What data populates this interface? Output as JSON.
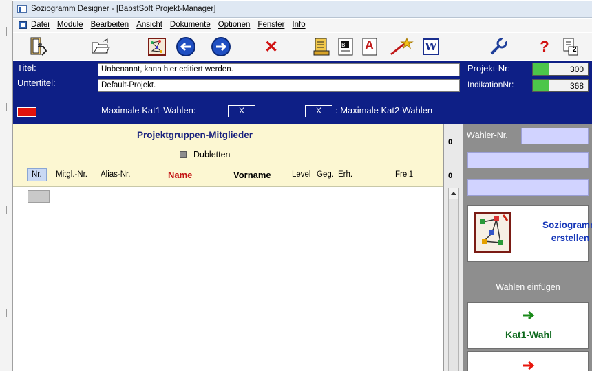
{
  "window": {
    "title": "Soziogramm Designer - [BabstSoft Projekt-Manager]"
  },
  "menu": {
    "items": [
      "Datei",
      "Module",
      "Bearbeiten",
      "Ansicht",
      "Dokumente",
      "Optionen",
      "Fenster",
      "Info"
    ]
  },
  "toolbar": {
    "icons": [
      "exit-icon",
      "open-folder-icon",
      "soziogramm-icon",
      "back-arrow-icon",
      "forward-arrow-icon",
      "delete-icon",
      "report-icon",
      "text-format-icon",
      "font-icon",
      "magic-wand-icon",
      "word-icon",
      "settings-wrench-icon",
      "help-icon",
      "page-count-icon"
    ],
    "help_label": "?",
    "delete_label": "✕",
    "word_label": "W",
    "font_label": "A",
    "page_num": "2"
  },
  "header": {
    "titel_label": "Titel:",
    "titel_value": "Unbenannt, kann hier editiert werden.",
    "untertitel_label": "Untertitel:",
    "untertitel_value": "Default-Projekt.",
    "projekt_nr_label": "Projekt-Nr:",
    "projekt_nr_value": "300",
    "indikation_nr_label": "IndikationNr:",
    "indikation_nr_value": "368",
    "max_kat1_label": "Maximale Kat1-Wahlen:",
    "max_kat1_value": "X",
    "max_kat2_value": "X",
    "max_kat2_label": ": Maximale Kat2-Wahlen",
    "colors": {
      "panel": "#0e1f86",
      "indicator": "#e1130c",
      "green": "#4cc64a"
    }
  },
  "members": {
    "title": "Projektgruppen-Mitglieder",
    "dubletten_label": "Dubletten",
    "columns": {
      "nr": "Nr.",
      "mitgl": "Mitgl.-Nr.",
      "alias": "Alias-Nr.",
      "name": "Name",
      "vorname": "Vorname",
      "level": "Level",
      "geg": "Geg.",
      "erh": "Erh.",
      "frei1": "Frei1"
    },
    "toggle1": "0",
    "toggle2": "0"
  },
  "right": {
    "waehler_label": "Wähler-Nr.",
    "sozio_line1": "Soziogramm",
    "sozio_line2": "erstellen",
    "wahlen_label": "Wahlen einfügen",
    "kat1_label": "Kat1-Wahl",
    "kat1_color": "#1a8a1a",
    "kat2_color": "#e8160c"
  }
}
